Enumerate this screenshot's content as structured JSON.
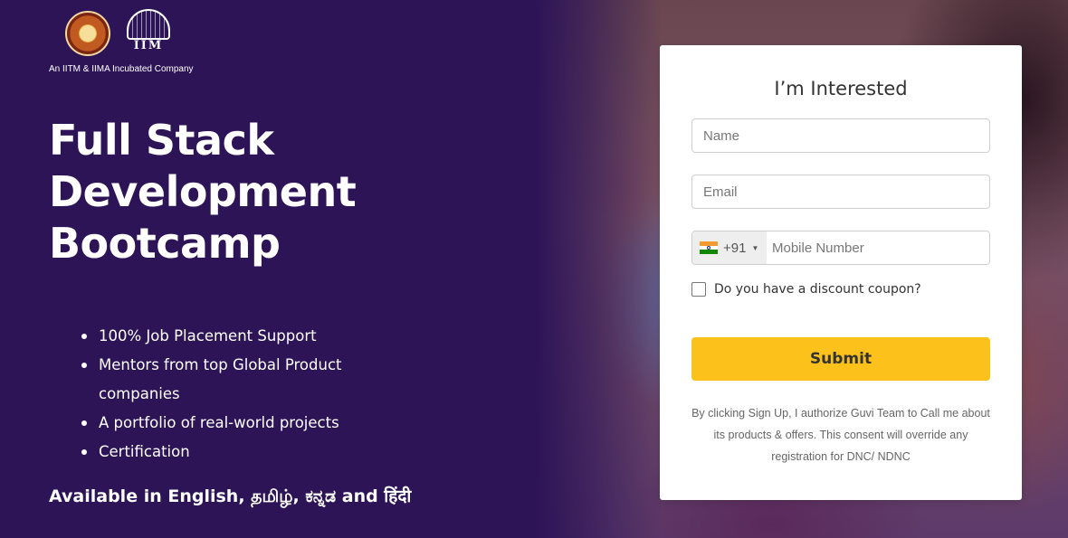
{
  "brand": {
    "tagline": "An IITM & IIMA Incubated Company",
    "iim_logo_text": "IIM"
  },
  "hero": {
    "title": "Full Stack Development Bootcamp"
  },
  "features": [
    "100% Job Placement Support",
    "Mentors from top Global Product companies",
    "A portfolio of real-world projects",
    "Certification"
  ],
  "languages_note": "Available in English, தமிழ், ಕನ್ನಡ and हिंदी",
  "form": {
    "title": "I’m Interested",
    "name_placeholder": "Name",
    "email_placeholder": "Email",
    "country_code": "+91",
    "country_flag": "india-flag-icon",
    "mobile_placeholder": "Mobile Number",
    "coupon_label": "Do you have a discount coupon?",
    "coupon_checked": false,
    "submit_label": "Submit",
    "consent_text": "By clicking Sign Up, I authorize Guvi Team to Call me about its products & offers. This consent will override any registration for DNC/ NDNC"
  },
  "colors": {
    "left_panel_bg": "#2d1457",
    "submit_bg": "#fcc21b"
  }
}
